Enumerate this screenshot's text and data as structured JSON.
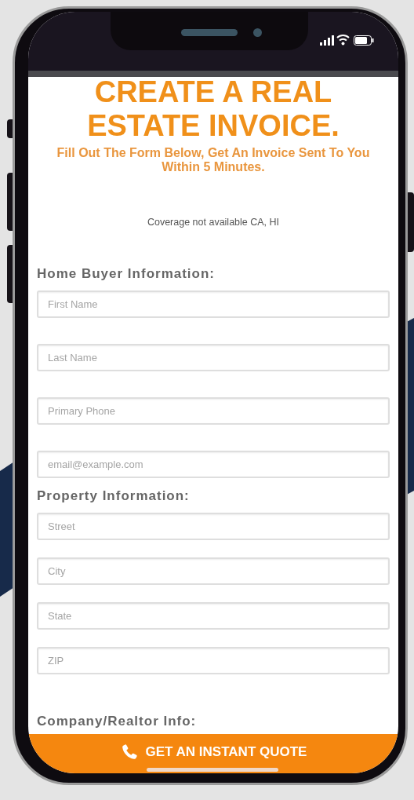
{
  "page": {
    "title": "CREATE A REAL ESTATE INVOICE.",
    "subtitle": "Fill Out The Form Below, Get An Invoice Sent To You Within 5 Minutes.",
    "notice": "Coverage not available CA, HI"
  },
  "sections": [
    {
      "heading": "Home Buyer Information:",
      "fields": [
        {
          "placeholder": "First Name"
        },
        {
          "placeholder": "Last Name"
        },
        {
          "placeholder": "Primary Phone"
        },
        {
          "placeholder": "email@example.com"
        }
      ]
    },
    {
      "heading": "Property Information:",
      "fields": [
        {
          "placeholder": "Street"
        },
        {
          "placeholder": "City"
        },
        {
          "placeholder": "State"
        },
        {
          "placeholder": "ZIP"
        }
      ]
    },
    {
      "heading": "Company/Realtor Info:"
    }
  ],
  "cta_button": {
    "label": "GET AN INSTANT QUOTE"
  }
}
